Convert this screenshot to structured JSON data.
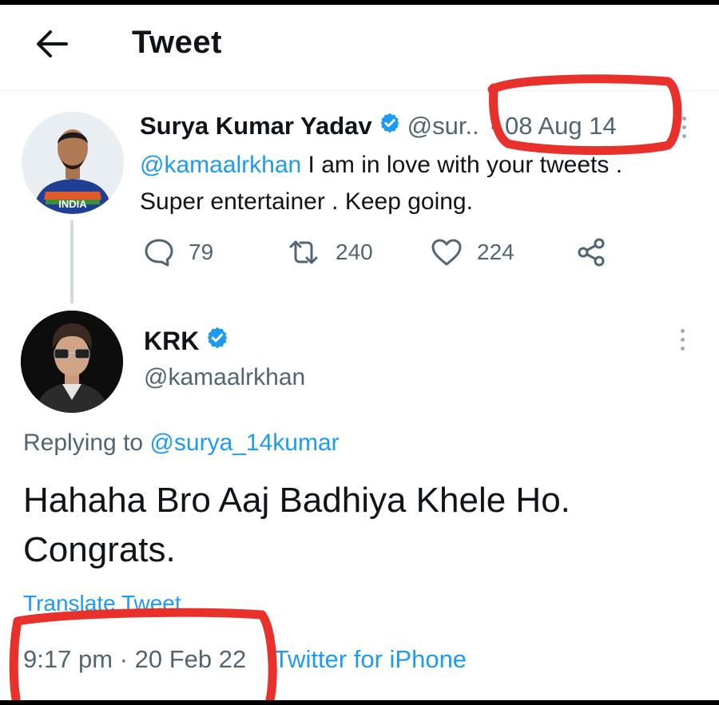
{
  "header": {
    "title": "Tweet",
    "back_icon": "arrow-left-icon"
  },
  "tweet_parent": {
    "display_name": "Surya Kumar Yadav",
    "handle": "@sur..",
    "separator": "·",
    "date": "08 Aug 14",
    "mention": "@kamaalrkhan",
    "text_line1_rest": " I am in love with your tweets .",
    "text_line2": "Super entertainer . Keep going.",
    "avatar_jersey_text": "INDIA",
    "actions": {
      "replies": "79",
      "retweets": "240",
      "likes": "224"
    }
  },
  "tweet_main": {
    "display_name": "KRK",
    "handle": "@kamaalrkhan",
    "replying_prefix": "Replying to ",
    "replying_to": "@surya_14kumar",
    "text_line1": "Hahaha Bro Aaj Badhiya Khele Ho.",
    "text_line2": "Congrats.",
    "translate_label": "Translate Tweet",
    "time": "9:17 pm",
    "separator": "·",
    "date": "20 Feb 22",
    "source": "Twitter for iPhone"
  },
  "colors": {
    "accent": "#1d9bf0",
    "secondary_text": "#536471",
    "annotation_red": "#e8312a"
  }
}
